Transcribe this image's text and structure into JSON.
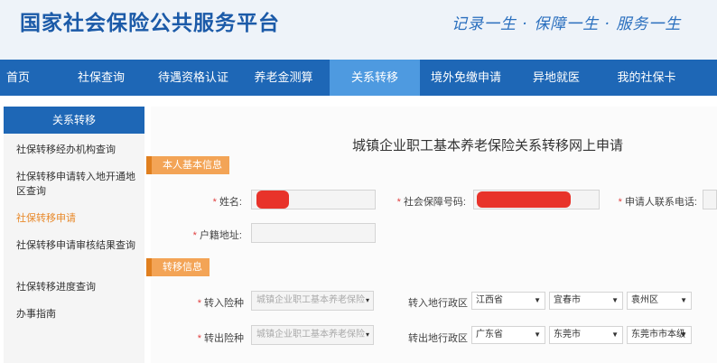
{
  "header": {
    "site_title": "国家社会保险公共服务平台",
    "slogan": "记录一生 · 保障一生 · 服务一生"
  },
  "nav": {
    "items": [
      {
        "label": "首页"
      },
      {
        "label": "社保查询"
      },
      {
        "label": "待遇资格认证"
      },
      {
        "label": "养老金测算"
      },
      {
        "label": "关系转移",
        "active": true
      },
      {
        "label": "境外免缴申请"
      },
      {
        "label": "异地就医"
      },
      {
        "label": "我的社保卡"
      }
    ]
  },
  "sidebar": {
    "heading": "关系转移",
    "items": [
      {
        "label": "社保转移经办机构查询"
      },
      {
        "label": "社保转移申请转入地开通地区查询"
      },
      {
        "label": "社保转移申请",
        "active": true
      },
      {
        "label": "社保转移申请审核结果查询"
      },
      {
        "label": "社保转移进度查询"
      },
      {
        "label": "办事指南"
      }
    ]
  },
  "form": {
    "title": "城镇企业职工基本养老保险关系转移网上申请",
    "section_basic": "本人基本信息",
    "section_transfer": "转移信息",
    "name_label": "姓名:",
    "ssn_label": "社会保障号码:",
    "phone_label": "申请人联系电话:",
    "address_label": "户籍地址:",
    "in_type_label": "转入险种",
    "in_type_value": "城镇企业职工基本养老保险",
    "in_region_label": "转入地行政区",
    "in_region": [
      "江西省",
      "宜春市",
      "袁州区"
    ],
    "out_type_label": "转出险种",
    "out_type_value": "城镇企业职工基本养老保险",
    "out_region_label": "转出地行政区",
    "out_region": [
      "广东省",
      "东莞市",
      "东莞市市本级"
    ]
  },
  "colors": {
    "brand_blue": "#1e67b6",
    "active_tab": "#4e9ae0",
    "section_orange": "#f3a456",
    "active_side_text": "#e8892a",
    "redaction": "#e8332a"
  }
}
